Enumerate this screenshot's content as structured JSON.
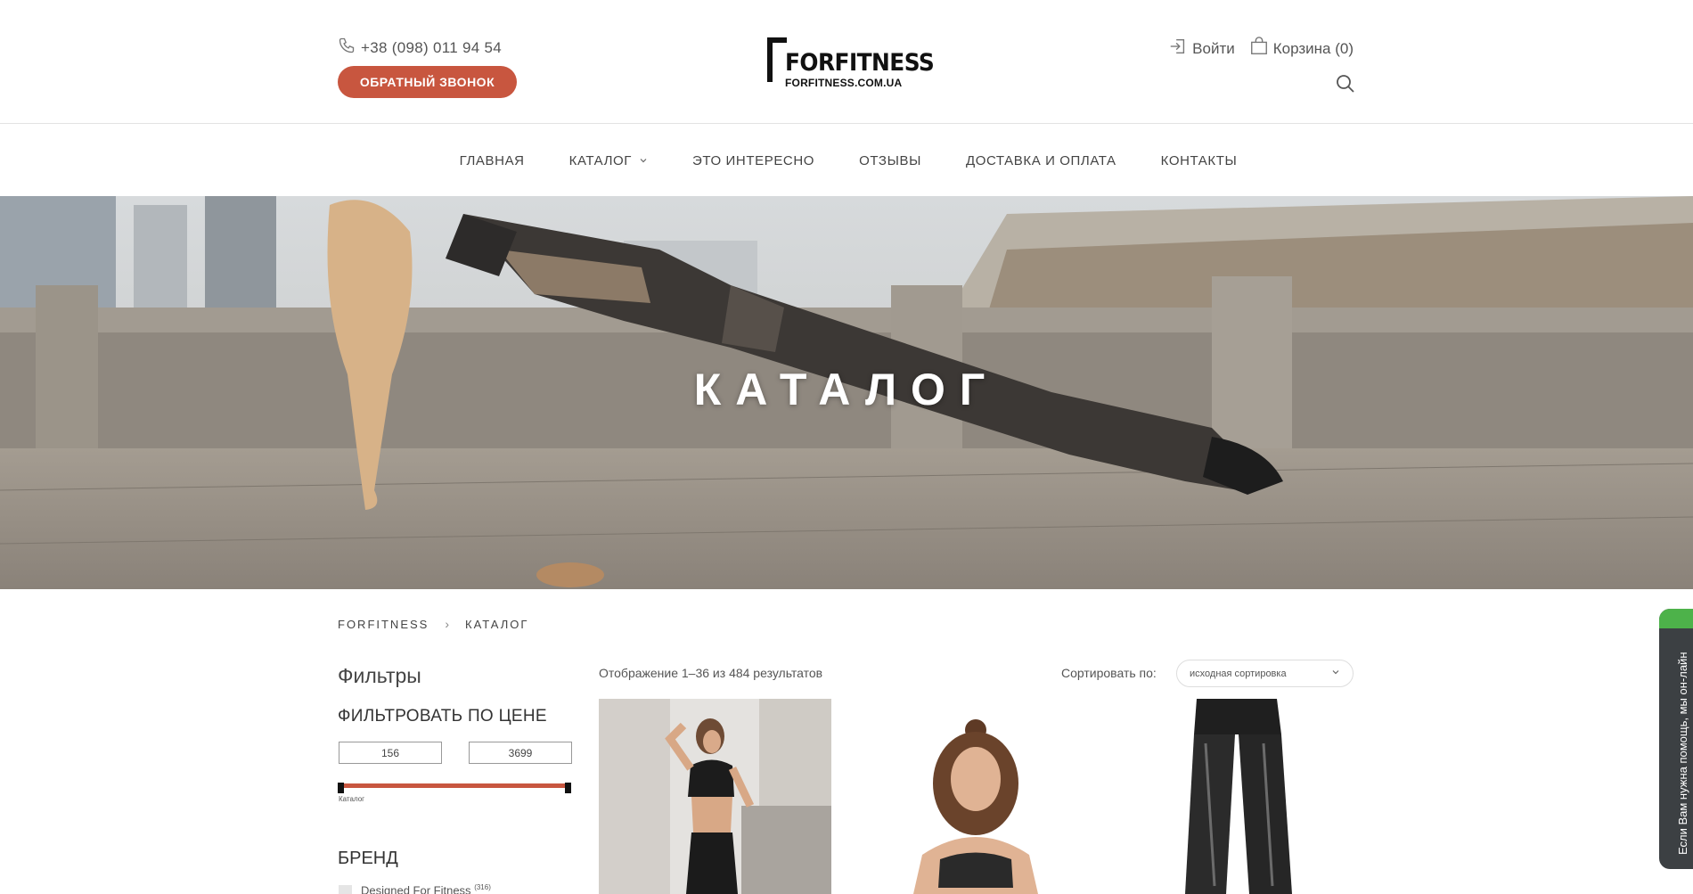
{
  "header": {
    "phone": "+38 (098) 011 94 54",
    "callback_label": "ОБРАТНЫЙ ЗВОНОК",
    "logo_brand": "FORFITNESS",
    "logo_domain": "FORFITNESS.COM.UA",
    "login_label": "Войти",
    "cart_label": "Корзина (0)"
  },
  "nav": {
    "items": [
      {
        "label": "ГЛАВНАЯ"
      },
      {
        "label": "КАТАЛОГ"
      },
      {
        "label": "ЭТО ИНТЕРЕСНО"
      },
      {
        "label": "ОТЗЫВЫ"
      },
      {
        "label": "ДОСТАВКА И ОПЛАТА"
      },
      {
        "label": "КОНТАКТЫ"
      }
    ]
  },
  "hero": {
    "title": "КАТАЛОГ"
  },
  "breadcrumb": {
    "home": "FORFITNESS",
    "current": "КАТАЛОГ"
  },
  "sidebar": {
    "filters_title": "Фильтры",
    "price_title": "ФИЛЬТРОВАТЬ ПО ЦЕНЕ",
    "price_min": "156",
    "price_max": "3699",
    "slider_label": "Каталог",
    "brand_title": "БРЕНД",
    "brands": [
      {
        "name": "Designed For Fitness",
        "count": "(316)"
      }
    ]
  },
  "main": {
    "result_count": "Отображение 1–36 из 484 результатов",
    "sort_label": "Сортировать по:",
    "sort_value": "исходная сортировка"
  },
  "chat": {
    "text": "Если Вам нужна помощь, мы он-лайн"
  },
  "colors": {
    "accent": "#c8563f",
    "chat_bg": "#3c4043",
    "chat_online": "#4db24a"
  },
  "icons": [
    "phone-icon",
    "login-icon",
    "cart-icon",
    "search-icon",
    "chevron-down-icon"
  ]
}
